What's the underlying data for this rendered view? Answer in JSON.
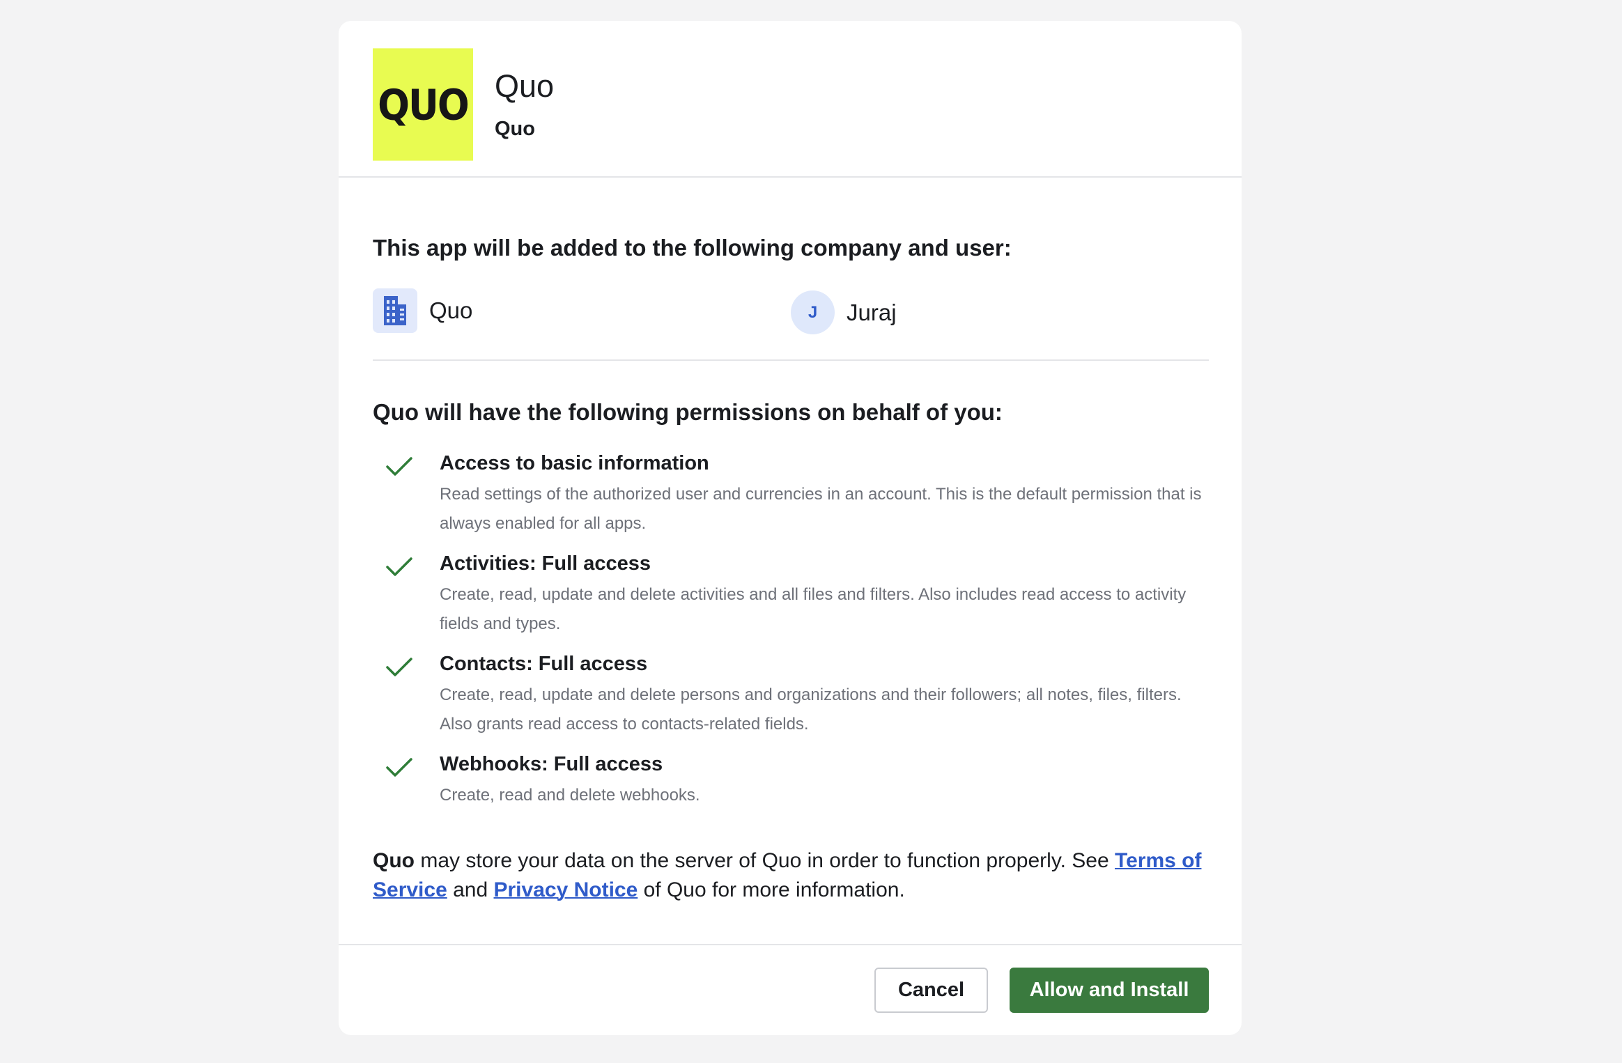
{
  "app": {
    "logo_text": "QUO",
    "title": "Quo",
    "subtitle": "Quo"
  },
  "install_target": {
    "heading": "This app will be added to the following company and user:",
    "company": {
      "icon": "building-icon",
      "name": "Quo"
    },
    "user": {
      "initial": "J",
      "name": "Juraj"
    }
  },
  "permissions": {
    "heading": "Quo will have the following permissions on behalf of you:",
    "items": [
      {
        "title": "Access to basic information",
        "description": "Read settings of the authorized user and currencies in an account. This is the default permission that is always enabled for all apps."
      },
      {
        "title": "Activities: Full access",
        "description": "Create, read, update and delete activities and all files and filters. Also includes read access to activity fields and types."
      },
      {
        "title": "Contacts: Full access",
        "description": "Create, read, update and delete persons and organizations and their followers; all notes, files, filters. Also grants read access to contacts-related fields."
      },
      {
        "title": "Webhooks: Full access",
        "description": "Create, read and delete webhooks."
      }
    ]
  },
  "data_notice": {
    "app_name": "Quo",
    "text_1": " may store your data on the server of Quo in order to function properly. See ",
    "terms_link": "Terms of Service",
    "text_2": " and ",
    "privacy_link": "Privacy Notice",
    "text_3": " of Quo for more information."
  },
  "actions": {
    "cancel_label": "Cancel",
    "allow_label": "Allow and Install"
  },
  "colors": {
    "logo_bg": "#e8fb51",
    "accent_green": "#3a7a3e",
    "link_blue": "#2f5bc9",
    "check_green": "#2f7d38"
  }
}
